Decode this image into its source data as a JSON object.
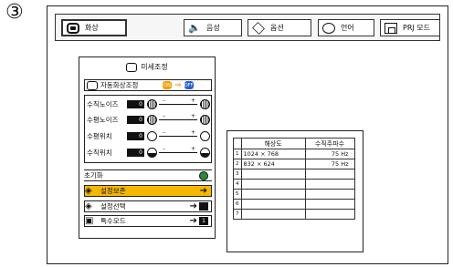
{
  "step_marker": "③",
  "menu_bar": {
    "tabs": [
      {
        "label": "화상",
        "icon": "screen-icon"
      },
      {
        "label": "음성",
        "icon": "speaker-icon"
      },
      {
        "label": "옵션",
        "icon": "options-icon"
      },
      {
        "label": "언어",
        "icon": "speech-bubble-icon"
      },
      {
        "label": "PRJ 모드",
        "icon": "prj-icon"
      }
    ]
  },
  "fine_sync_panel": {
    "title": "미세조정",
    "auto_sync": {
      "label": "자동화상조정",
      "on_text": "ON",
      "off_text": "OFF"
    },
    "adjustments": [
      {
        "label": "수직노이즈",
        "value": "0"
      },
      {
        "label": "수평노이즈",
        "value": "0"
      },
      {
        "label": "수평위치",
        "value": "0"
      },
      {
        "label": "수직위치",
        "value": "0"
      }
    ],
    "reset_label": "초기화",
    "save_label": "설정보존",
    "select_label": "설정선택",
    "special_mode_label": "특수모드",
    "special_mode_box": "1"
  },
  "resolution_table": {
    "headers": [
      "해상도",
      "수직주파수"
    ],
    "rows": [
      {
        "num": "1",
        "resolution": "1024 × 768",
        "freq": "75 Hz"
      },
      {
        "num": "2",
        "resolution": "832 × 624",
        "freq": "75 Hz"
      },
      {
        "num": "3",
        "resolution": "",
        "freq": ""
      },
      {
        "num": "4",
        "resolution": "",
        "freq": ""
      },
      {
        "num": "5",
        "resolution": "",
        "freq": ""
      },
      {
        "num": "6",
        "resolution": "",
        "freq": ""
      },
      {
        "num": "7",
        "resolution": "",
        "freq": ""
      }
    ]
  },
  "colors": {
    "highlight": "#f5b800",
    "on": "#f2a000",
    "off": "#2a60d0",
    "reset": "#2a8a3a"
  }
}
